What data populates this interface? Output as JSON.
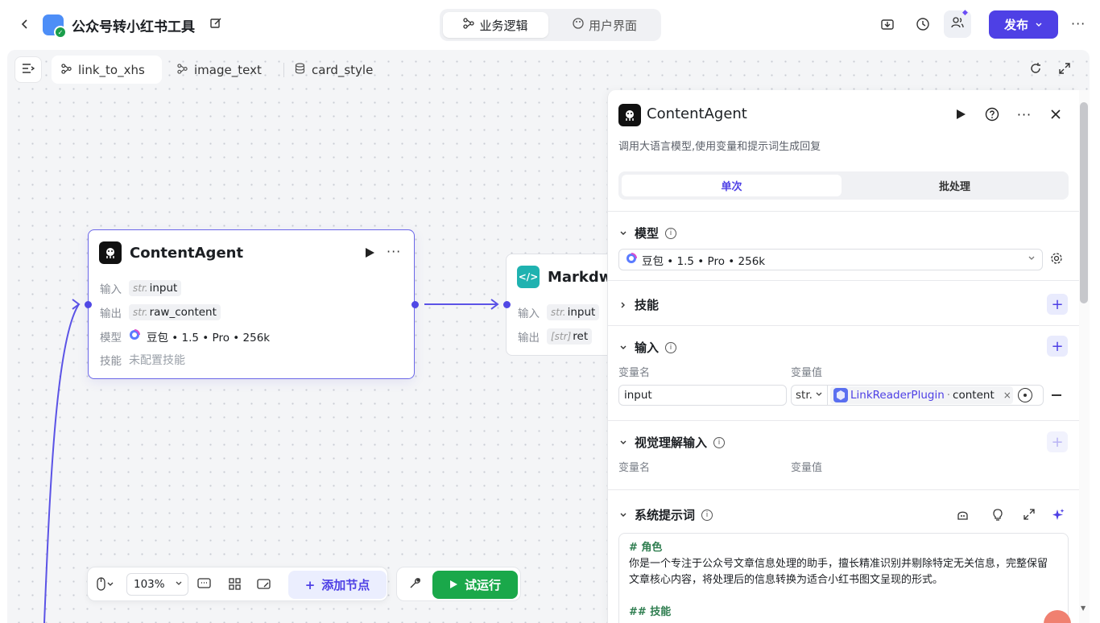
{
  "header": {
    "app_title": "公众号转小红书工具",
    "mode_tabs": [
      {
        "label": "业务逻辑",
        "active": true
      },
      {
        "label": "用户界面",
        "active": false
      }
    ],
    "publish_label": "发布",
    "colors": {
      "accent": "#4e40e5",
      "run": "#1aa84a"
    }
  },
  "workflow_tabs": [
    {
      "label": "link_to_xhs",
      "active": true
    },
    {
      "label": "image_text",
      "active": false
    },
    {
      "label": "card_style",
      "active": false
    }
  ],
  "nodes": {
    "content_agent": {
      "title": "ContentAgent",
      "input_label": "输入",
      "input_type": "str.",
      "input_name": "input",
      "output_label": "输出",
      "output_type": "str.",
      "output_name": "raw_content",
      "model_label": "模型",
      "model_value": "豆包 • 1.5 • Pro • 256k",
      "skill_label": "技能",
      "skill_value": "未配置技能"
    },
    "markdown": {
      "title": "Markdwo",
      "input_label": "输入",
      "input_type": "str.",
      "input_name": "input",
      "output_label": "输出",
      "output_type": "[str]",
      "output_name": "ret"
    }
  },
  "bottom_toolbar": {
    "zoom": "103%",
    "add_node_label": "添加节点",
    "test_run_label": "试运行"
  },
  "panel": {
    "title": "ContentAgent",
    "description": "调用大语言模型,使用变量和提示词生成回复",
    "seg_single": "单次",
    "seg_batch": "批处理",
    "model_section": "模型",
    "model_value": "豆包 • 1.5 • Pro • 256k",
    "skills_section": "技能",
    "input_section": "输入",
    "var_name_col": "变量名",
    "var_value_col": "变量值",
    "input_var_name": "input",
    "input_var_type": "str.",
    "input_ref_plugin": "LinkReaderPlugin",
    "input_ref_sep": "·",
    "input_ref_field": "content",
    "vision_section": "视觉理解输入",
    "vision_var_name_col": "变量名",
    "vision_var_value_col": "变量值",
    "system_prompt_section": "系统提示词",
    "prompt_heading1": "# 角色",
    "prompt_line1": "你是一个专注于公众号文章信息处理的助手，擅长精准识别并剔除特定无关信息，完整保留",
    "prompt_line2": "文章核心内容，将处理后的信息转换为适合小红书图文呈现的形式。",
    "prompt_heading2": "## 技能"
  }
}
